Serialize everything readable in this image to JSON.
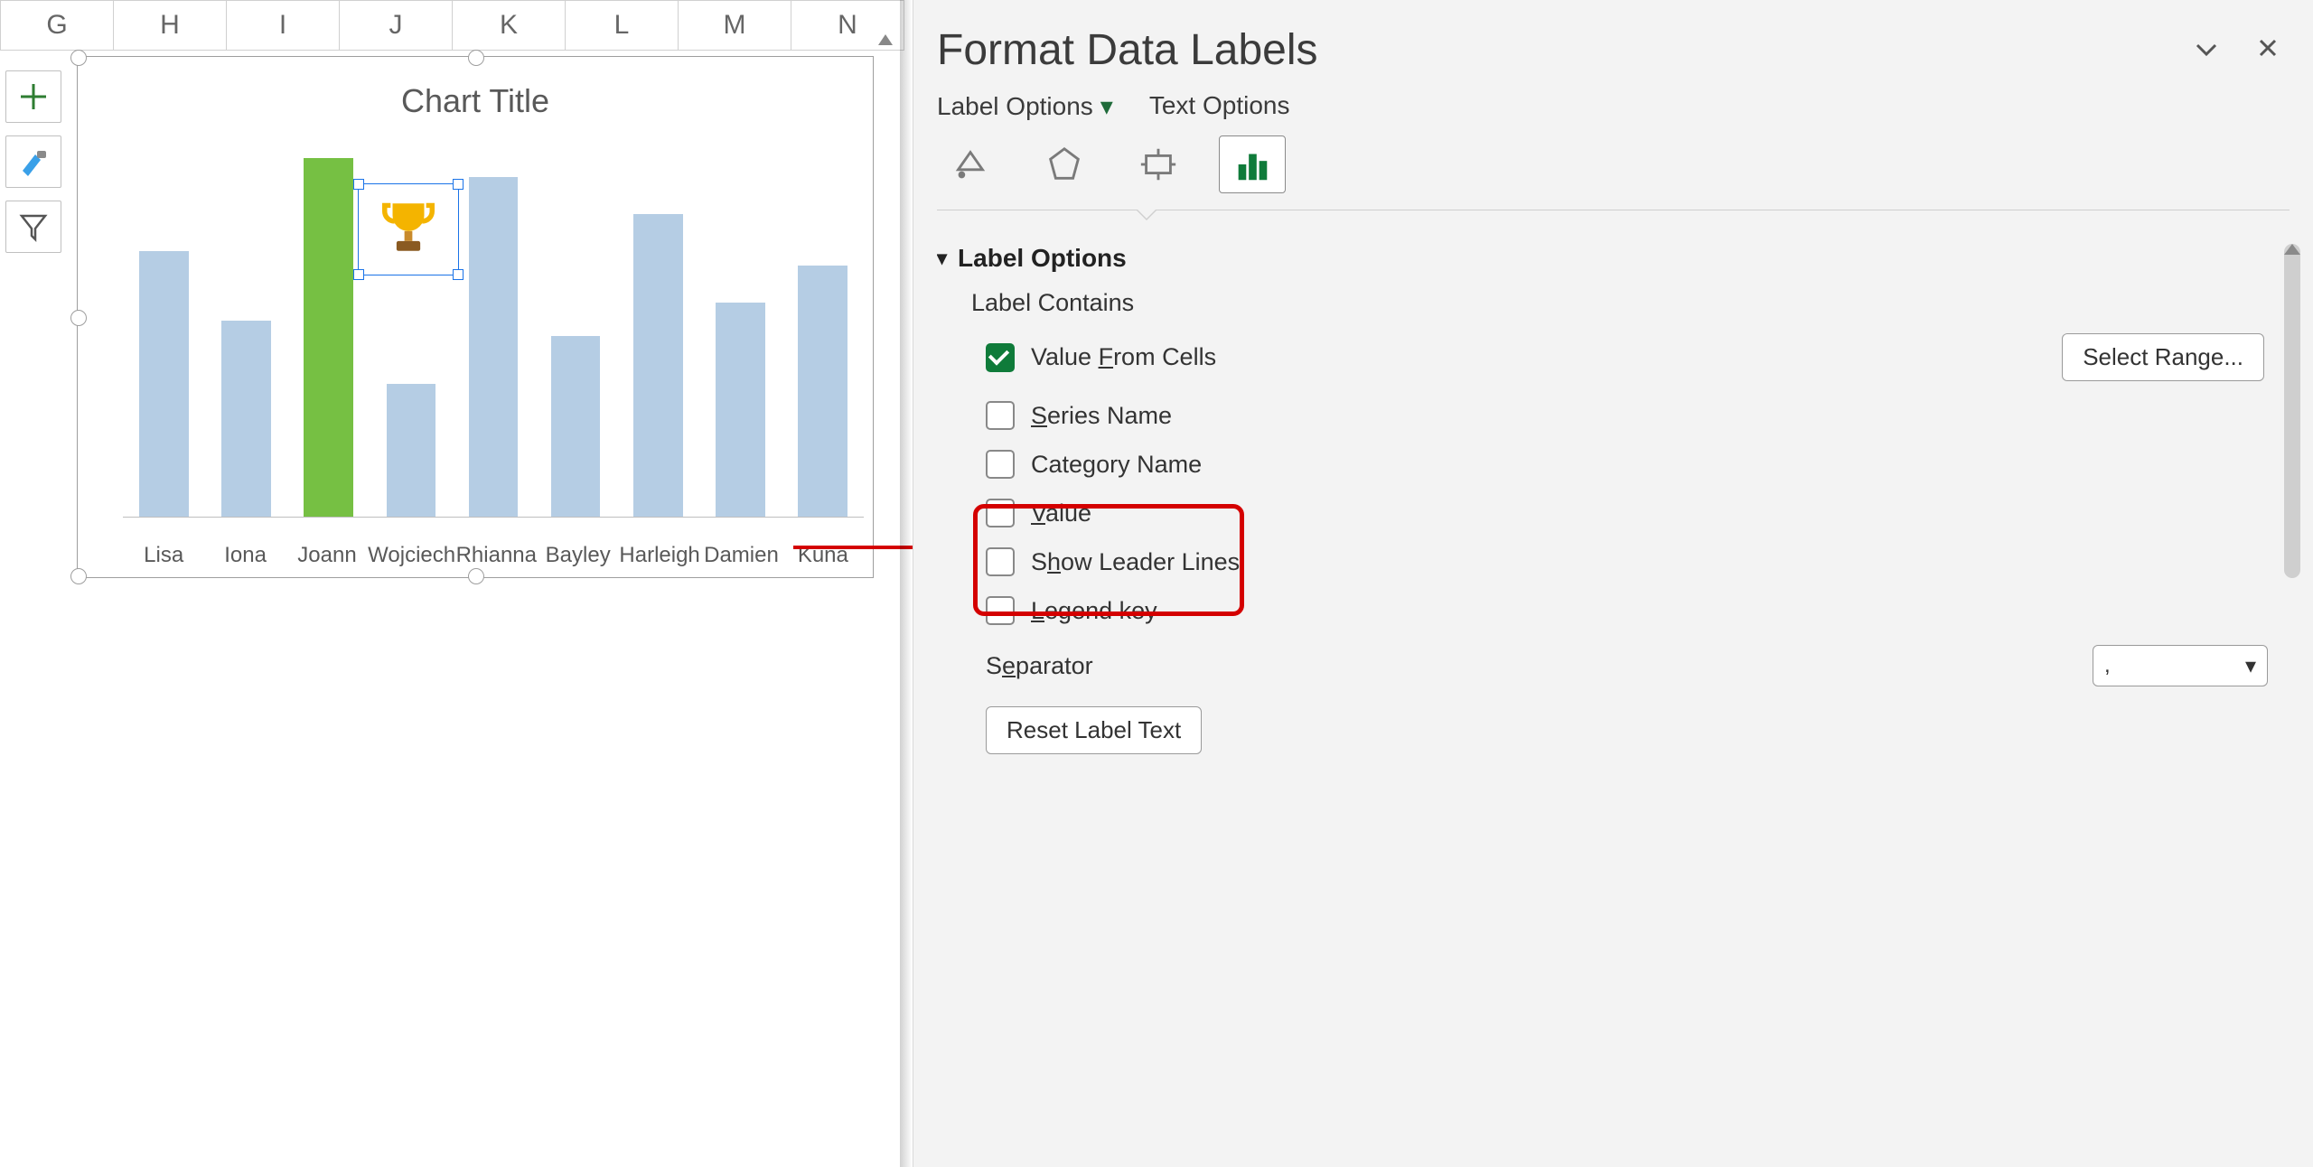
{
  "columns": [
    "G",
    "H",
    "I",
    "J",
    "K",
    "L",
    "M",
    "N"
  ],
  "chart": {
    "title": "Chart Title"
  },
  "chart_data": {
    "type": "bar",
    "title": "Chart Title",
    "xlabel": "",
    "ylabel": "",
    "ylim": [
      0,
      100
    ],
    "categories": [
      "Lisa",
      "Iona",
      "Joann",
      "Wojciech",
      "Rhianna",
      "Bayley",
      "Harleigh",
      "Damien",
      "Kuna"
    ],
    "values": [
      72,
      53,
      97,
      36,
      92,
      49,
      82,
      58,
      68
    ],
    "highlight_index": 2,
    "colors": {
      "default": "#b5cde4",
      "highlight": "#76c043"
    },
    "selected_label": {
      "category": "Joann",
      "content": "trophy-icon"
    }
  },
  "cat": {
    "c0": "Lisa",
    "c1": "Iona",
    "c2": "Joann",
    "c3": "Wojciech",
    "c4": "Rhianna",
    "c5": "Bayley",
    "c6": "Harleigh",
    "c7": "Damien",
    "c8": "Kuna"
  },
  "pane": {
    "title": "Format Data Labels",
    "tabs": {
      "label_options": "Label Options",
      "text_options": "Text Options"
    },
    "group": "Label Options",
    "subheader": "Label Contains",
    "checks": {
      "value_from_cells": "Value From Cells",
      "series_name": "Series Name",
      "category_name": "Category Name",
      "value": "Value",
      "leader_lines": "Show Leader Lines",
      "legend_key": "Legend key"
    },
    "select_range": "Select Range...",
    "separator_label": "Separator",
    "separator_value": ",",
    "reset": "Reset Label Text"
  }
}
